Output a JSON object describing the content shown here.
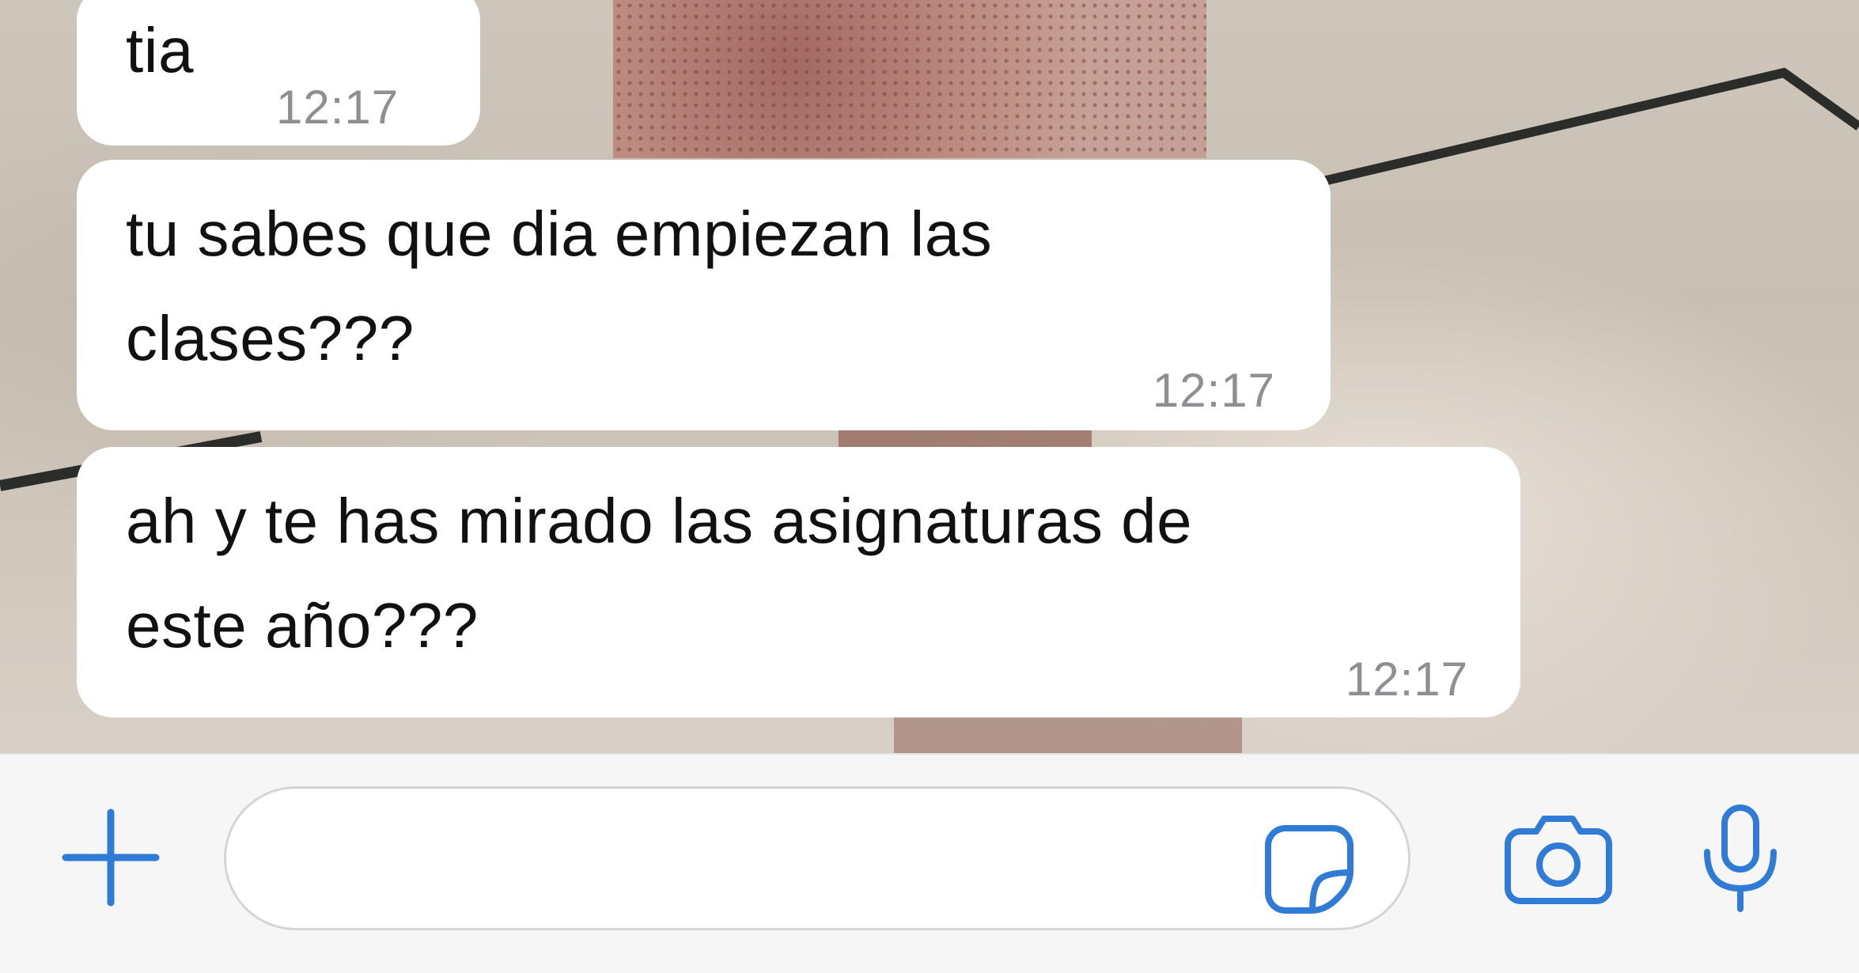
{
  "messages": [
    {
      "text": "tia",
      "time": "12:17"
    },
    {
      "text": "tu sabes que dia empiezan las\nclases???",
      "time": "12:17"
    },
    {
      "text": "ah y te has mirado las asignaturas de\neste año???",
      "time": "12:17"
    }
  ],
  "composer": {
    "placeholder": "",
    "value": "",
    "icons": {
      "attach": "plus-icon",
      "sticker": "sticker-icon",
      "camera": "camera-icon",
      "mic": "microphone-icon"
    },
    "icon_color": "#2f7bd6"
  },
  "colors": {
    "bubble": "#ffffff",
    "timestamp": "#8e8e93",
    "message_text": "#111111",
    "composer_background": "#f6f6f7"
  }
}
